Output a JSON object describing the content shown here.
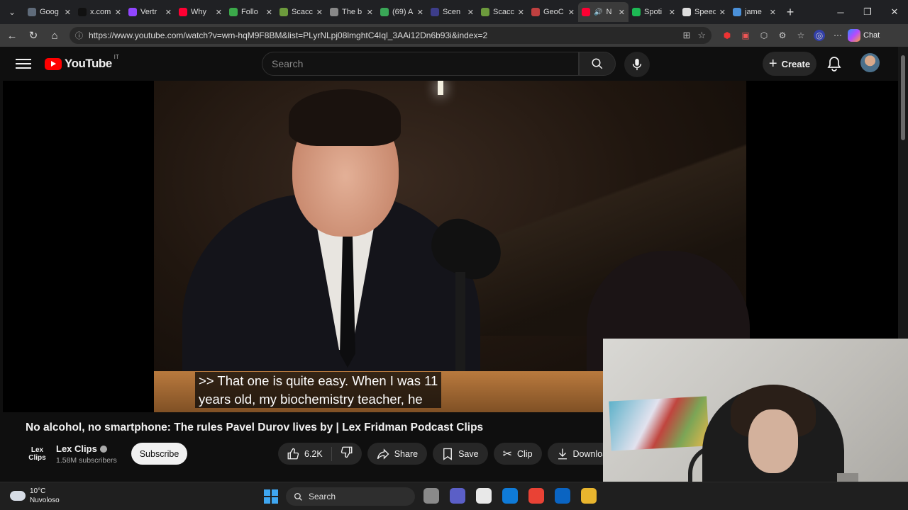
{
  "browser": {
    "tabs": [
      {
        "label": "Goog",
        "color": "#5f6b7a"
      },
      {
        "label": "x.com",
        "color": "#111111"
      },
      {
        "label": "Vertr",
        "color": "#9146ff"
      },
      {
        "label": "Why",
        "color": "#ff0033"
      },
      {
        "label": "Follo",
        "color": "#3ba94a"
      },
      {
        "label": "Scacc",
        "color": "#6c9a3c"
      },
      {
        "label": "The b",
        "color": "#888888"
      },
      {
        "label": "(69) A",
        "color": "#3aa757"
      },
      {
        "label": "Scen",
        "color": "#3d3d8a"
      },
      {
        "label": "Scacc",
        "color": "#6c9a3c"
      },
      {
        "label": "GeoC",
        "color": "#c04040"
      },
      {
        "label": "N",
        "color": "#ff0033",
        "active": true
      },
      {
        "label": "Spoti",
        "color": "#1db954"
      },
      {
        "label": "Speed",
        "color": "#dddddd"
      },
      {
        "label": "jame",
        "color": "#4a90d9"
      }
    ],
    "url": "https://www.youtube.com/watch?v=wm-hqM9F8BM&list=PLyrNLpj08lmghtC4Iql_3AAi12Dn6b93i&index=2",
    "chat_label": "Chat"
  },
  "youtube": {
    "logo_text": "YouTube",
    "country_code": "IT",
    "search_placeholder": "Search",
    "create_label": "Create"
  },
  "video": {
    "caption_line1": ">> That one is quite easy. When I was 11",
    "caption_line2": "years old, my biochemistry teacher, he",
    "title": "No alcohol, no smartphone: The rules Pavel Durov lives by | Lex Fridman Podcast Clips"
  },
  "channel": {
    "avatar_line1": "Lex",
    "avatar_line2": "Clips",
    "name": "Lex Clips",
    "subscribers": "1.58M subscribers",
    "subscribe_label": "Subscribe"
  },
  "actions": {
    "likes": "6.2K",
    "share": "Share",
    "save": "Save",
    "clip": "Clip",
    "download": "Download"
  },
  "taskbar": {
    "temperature": "10°C",
    "weather": "Nuvoloso",
    "search_label": "Search",
    "pinned_colors": [
      "#8a8a8a",
      "#5b5fc7",
      "#e8e8e8",
      "#0f7bd8",
      "#e94235",
      "#0a64c2",
      "#e8b52e"
    ]
  }
}
